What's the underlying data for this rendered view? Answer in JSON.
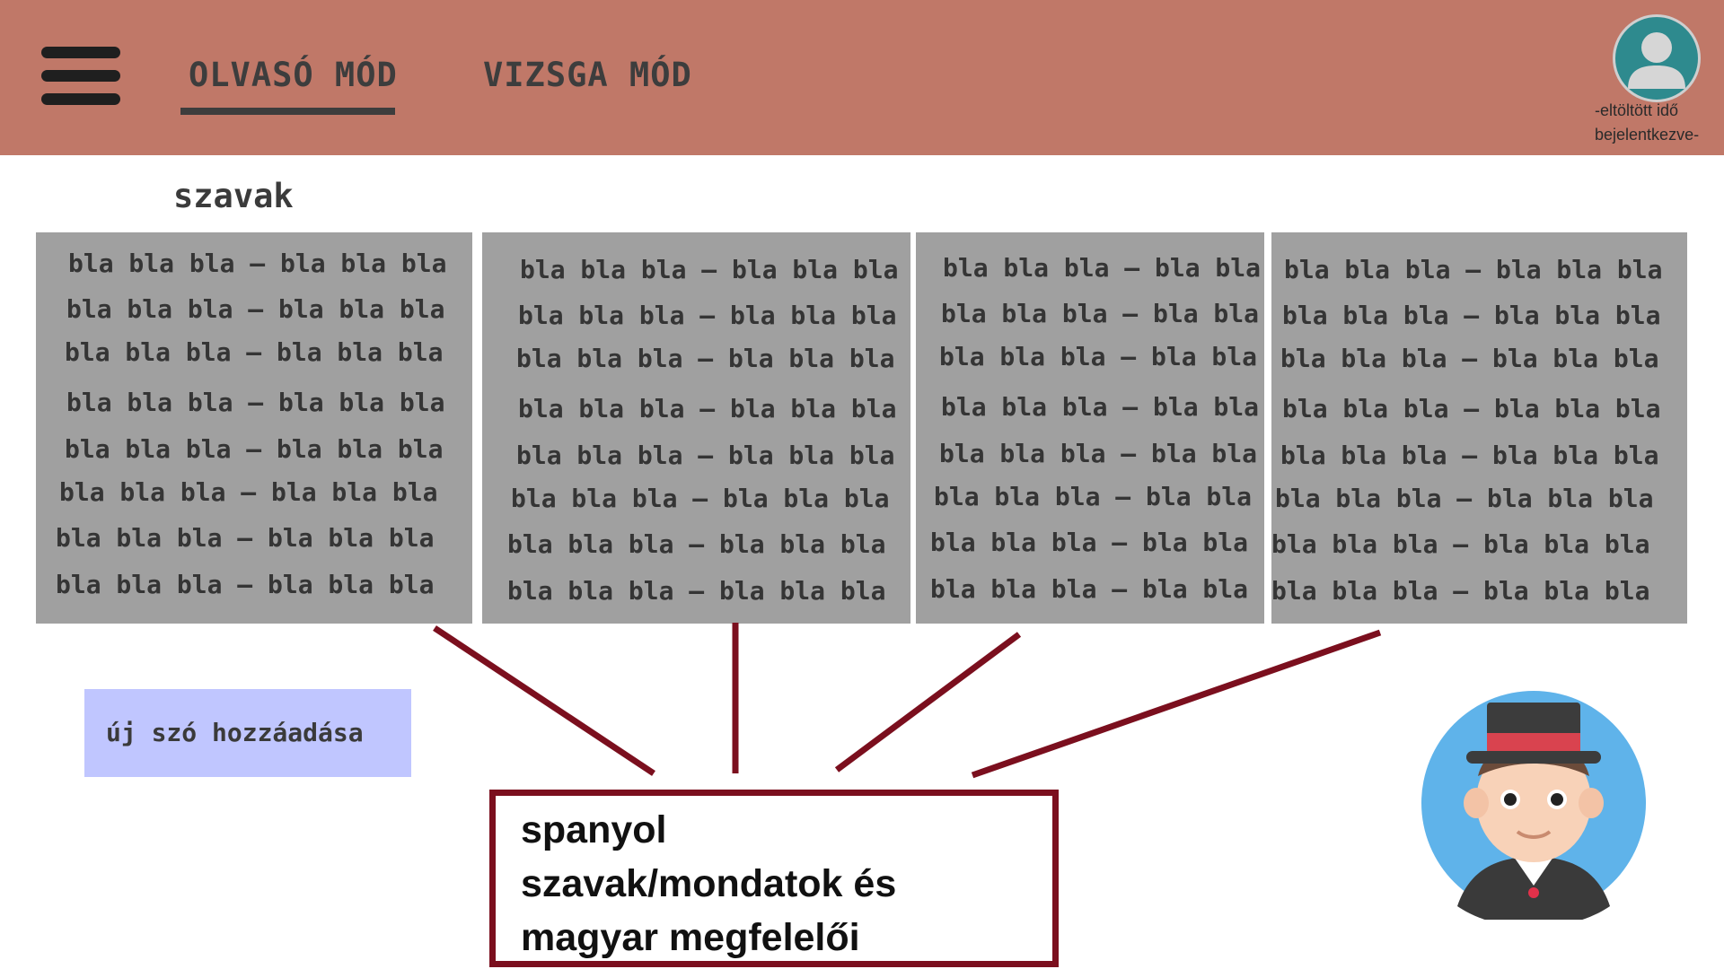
{
  "header": {
    "tabs": [
      {
        "label": "OLVASÓ MÓD",
        "active": true
      },
      {
        "label": "VIZSGA MÓD",
        "active": false
      }
    ],
    "user": {
      "line1": "-eltöltött idő",
      "line2": "bejelentkezve-",
      "avatar_icon": "user-avatar-icon"
    },
    "menu_icon": "hamburger-menu-icon"
  },
  "section_title": "szavak",
  "panels": [
    {
      "lines": [
        "bla bla bla – bla bla bla",
        "bla bla bla – bla bla bla",
        "bla bla bla – bla bla bla",
        "bla bla bla – bla bla bla",
        "bla bla bla – bla bla bla",
        "bla bla bla – bla bla bla",
        "bla bla bla – bla bla bla",
        "bla bla bla – bla bla bla"
      ]
    },
    {
      "lines": [
        "bla bla bla – bla bla bla",
        "bla bla bla – bla bla bla",
        "bla bla bla – bla bla bla",
        "bla bla bla – bla bla bla",
        "bla bla bla – bla bla bla",
        "bla bla bla – bla bla bla",
        "bla bla bla – bla bla bla",
        "bla bla bla – bla bla bla"
      ]
    },
    {
      "lines": [
        "bla bla bla – bla bla bla",
        "bla bla bla – bla bla bla",
        "bla bla bla – bla bla bla",
        "bla bla bla – bla bla bla",
        "bla bla bla – bla bla bla",
        "bla bla bla – bla bla bla",
        "bla bla bla – bla bla bla",
        "bla bla bla – bla bla bla"
      ]
    },
    {
      "lines": [
        "bla bla bla – bla bla bla",
        "bla bla bla – bla bla bla",
        "bla bla bla – bla bla bla",
        "bla bla bla – bla bla bla",
        "bla bla bla – bla bla bla",
        "bla bla bla – bla bla bla",
        "bla bla bla – bla bla bla",
        "bla bla bla – bla bla bla"
      ]
    }
  ],
  "add_button_label": "új szó hozzáadása",
  "callout_lines": [
    "spanyol",
    "szavak/mondatok és",
    "magyar megfelelői"
  ],
  "colors": {
    "header": "#c07868",
    "panel": "#a0a0a0",
    "button": "#c0c6ff",
    "connector": "#7b0f1e",
    "avatar": "#2e8a8e"
  },
  "mascot_icon": "boy-with-hat-avatar-icon"
}
